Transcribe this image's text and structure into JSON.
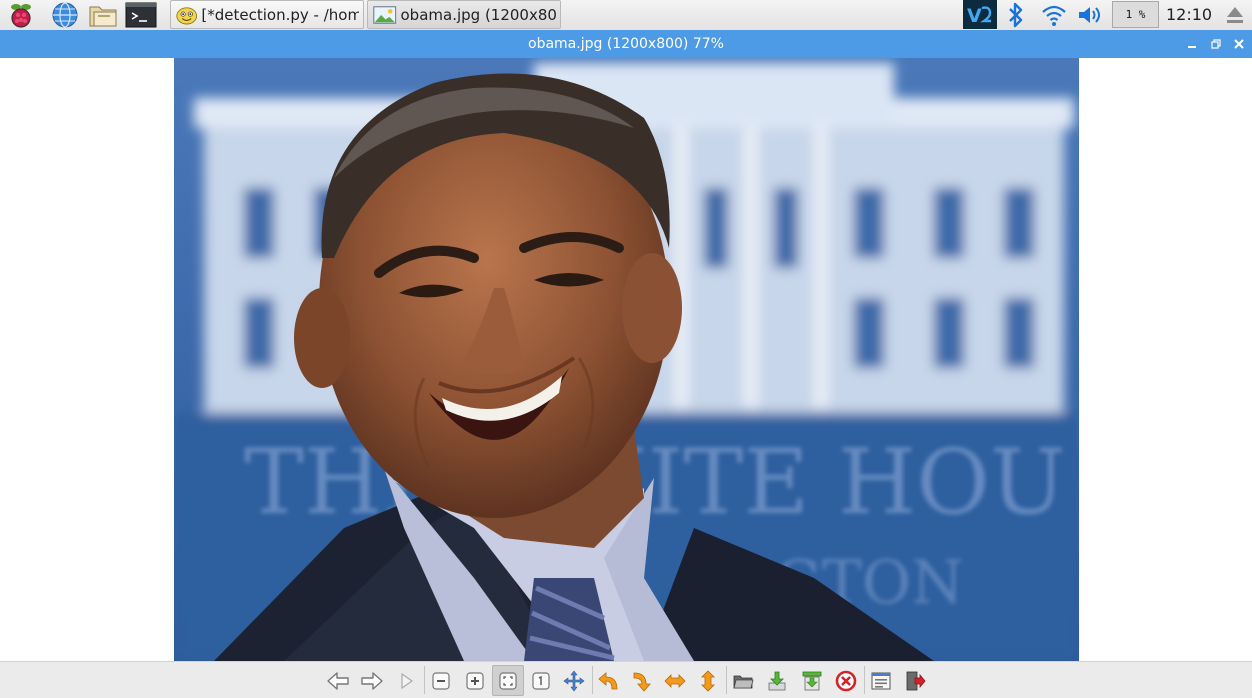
{
  "taskbar": {
    "launchers": [
      {
        "icon": "raspberry-menu-icon"
      },
      {
        "icon": "web-browser-icon"
      },
      {
        "icon": "file-manager-icon"
      },
      {
        "icon": "terminal-icon"
      }
    ],
    "tasks": [
      {
        "icon": "thonny-icon",
        "label": "[*detection.py - /hom..."
      },
      {
        "icon": "image-viewer-icon",
        "label": "obama.jpg (1200x80..."
      }
    ],
    "tray": {
      "vnc_icon": "vnc-icon",
      "bluetooth_icon": "bluetooth-icon",
      "wifi_icon": "wifi-icon",
      "volume_icon": "volume-icon",
      "cpu_usage": "1 %",
      "clock": "12:10",
      "eject_icon": "eject-icon"
    }
  },
  "window": {
    "title": "obama.jpg (1200x800) 77%",
    "controls": [
      "minimize-icon",
      "maximize-icon",
      "close-icon"
    ]
  },
  "image": {
    "background_text_1": "THE WHITE HOU",
    "background_text_2": "GTON"
  },
  "toolbar": {
    "tools": [
      "previous-icon",
      "next-icon",
      "slideshow-icon",
      "zoom-out-icon",
      "zoom-in-icon",
      "zoom-fit-icon",
      "original-size-icon",
      "fullscreen-icon",
      "rotate-left-icon",
      "rotate-right-icon",
      "flip-horizontal-icon",
      "flip-vertical-icon",
      "open-file-icon",
      "save-file-icon",
      "save-as-icon",
      "delete-icon",
      "preferences-icon",
      "quit-icon"
    ],
    "pressed_tool": "zoom-fit-icon"
  },
  "colors": {
    "title_bar": "#4d9be6",
    "taskbar": "#ececec",
    "photo_background": "#3567a8"
  }
}
